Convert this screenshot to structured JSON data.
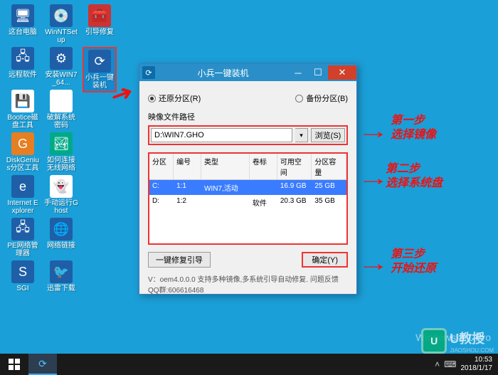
{
  "desktop_icons": [
    {
      "label": "这台电脑",
      "r": 0,
      "c": 0,
      "glyph": "🖥",
      "bg": "blue-bg"
    },
    {
      "label": "WinNTSetup",
      "r": 0,
      "c": 1,
      "glyph": "💿",
      "bg": "blue-bg"
    },
    {
      "label": "引导修复",
      "r": 0,
      "c": 2,
      "glyph": "🧰",
      "bg": "red-bg"
    },
    {
      "label": "远程软件",
      "r": 1,
      "c": 0,
      "glyph": "🖧",
      "bg": "blue-bg"
    },
    {
      "label": "安装WIN7_64...",
      "r": 1,
      "c": 1,
      "glyph": "⚙",
      "bg": "blue-bg"
    },
    {
      "label": "小兵一键装机",
      "r": 1,
      "c": 2,
      "glyph": "⟳",
      "bg": "blue-bg",
      "hl": true
    },
    {
      "label": "Bootice磁盘工具",
      "r": 2,
      "c": 0,
      "glyph": "💾",
      "bg": "white-bg"
    },
    {
      "label": "破解系统密码",
      "r": 2,
      "c": 1,
      "glyph": "NT",
      "bg": "white-bg"
    },
    {
      "label": "DiskGenius分区工具",
      "r": 3,
      "c": 0,
      "glyph": "G",
      "bg": "orange-bg"
    },
    {
      "label": "如何连接无线网络",
      "r": 3,
      "c": 1,
      "glyph": "🏞",
      "bg": "teal-bg"
    },
    {
      "label": "Internet Explorer",
      "r": 4,
      "c": 0,
      "glyph": "e",
      "bg": "blue-bg"
    },
    {
      "label": "手动运行Ghost",
      "r": 4,
      "c": 1,
      "glyph": "👻",
      "bg": "white-bg"
    },
    {
      "label": "PE网络管理器",
      "r": 5,
      "c": 0,
      "glyph": "🖧",
      "bg": "blue-bg"
    },
    {
      "label": "网络链接",
      "r": 5,
      "c": 1,
      "glyph": "🌐",
      "bg": "blue-bg"
    },
    {
      "label": "SGI",
      "r": 6,
      "c": 0,
      "glyph": "S",
      "bg": "blue-bg"
    },
    {
      "label": "迅雷下载",
      "r": 6,
      "c": 1,
      "glyph": "🐦",
      "bg": "blue-bg"
    }
  ],
  "dialog": {
    "title": "小兵一键装机",
    "radio_restore": "还原分区(R)",
    "radio_backup": "备份分区(B)",
    "path_label": "映像文件路径",
    "path_value": "D:\\WIN7.GHO",
    "browse_btn": "浏览(S)",
    "table_headers": {
      "c1": "分区",
      "c2": "编号",
      "c3": "类型",
      "c4": "卷标",
      "c5": "可用空间",
      "c6": "分区容量"
    },
    "rows": [
      {
        "c1": "C:",
        "c2": "1:1",
        "c3": "WIN7,活动",
        "c4": "",
        "c5": "16.9 GB",
        "c6": "25 GB",
        "sel": true
      },
      {
        "c1": "D:",
        "c2": "1:2",
        "c3": "",
        "c4": "软件",
        "c5": "20.3 GB",
        "c6": "35 GB",
        "sel": false
      }
    ],
    "repair_btn": "一键修复引导",
    "ok_btn": "确定(Y)",
    "status": "V：oem4.0.0.0      支持多种镜像,多系统引导自动修复. 问题反馈QQ群:606616468"
  },
  "annotations": {
    "step1_title": "第一步",
    "step1_text": "选择镜像",
    "step2_title": "第二步",
    "step2_text": "选择系统盘",
    "step3_title": "第三步",
    "step3_text": "开始还原"
  },
  "watermark": {
    "line1": "Windows 8.1 Pro",
    "line2": ""
  },
  "ujiaoshou": {
    "logo_text": "U",
    "label": "U教授",
    "sub": "JIAOSHOU.COM"
  },
  "taskbar": {
    "time": "10:53",
    "date": "2018/1/17"
  }
}
